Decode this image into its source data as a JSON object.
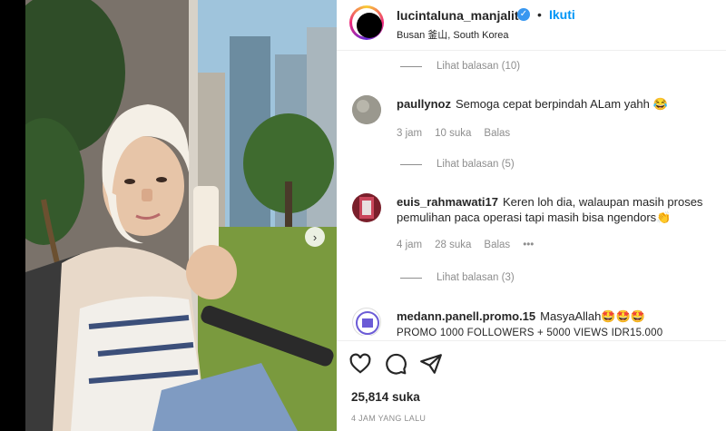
{
  "post": {
    "username": "lucintaluna_manjalita",
    "follow_label": "Ikuti",
    "separator": "•",
    "location": "Busan 釜山, South Korea"
  },
  "comments": [
    {
      "type": "replies",
      "label": "Lihat balasan (10)"
    },
    {
      "type": "comment",
      "username": "paullynoz",
      "text": "Semoga cepat berpindah ALam yahh 😂",
      "age": "3 jam",
      "likes": "10 suka",
      "reply": "Balas"
    },
    {
      "type": "replies",
      "label": "Lihat balasan (5)"
    },
    {
      "type": "comment",
      "username": "euis_rahmawati17",
      "text": "Keren loh dia, walaupan masih proses pemulihan paca operasi tapi masih bisa ngendors👏",
      "age": "4 jam",
      "likes": "28 suka",
      "reply": "Balas",
      "more": "•••"
    },
    {
      "type": "replies",
      "label": "Lihat balasan (3)"
    },
    {
      "type": "comment",
      "username": "medann.panell.promo.15",
      "text": "MasyaAllah🤩🤩🤩",
      "text2": "PROMO 1000 FOLLOWERS + 5000 VIEWS IDR15.000"
    }
  ],
  "footer": {
    "likes": "25,814 suka",
    "time": "4 JAM YANG LALU"
  },
  "icons": {
    "like": "heart-icon",
    "comment": "comment-bubble-icon",
    "share": "paper-plane-icon",
    "next": "chevron-right-icon",
    "verified": "verified-badge-icon"
  },
  "colors": {
    "link": "#0095f6",
    "verified": "#3897f0",
    "muted": "#8e8e8e"
  }
}
